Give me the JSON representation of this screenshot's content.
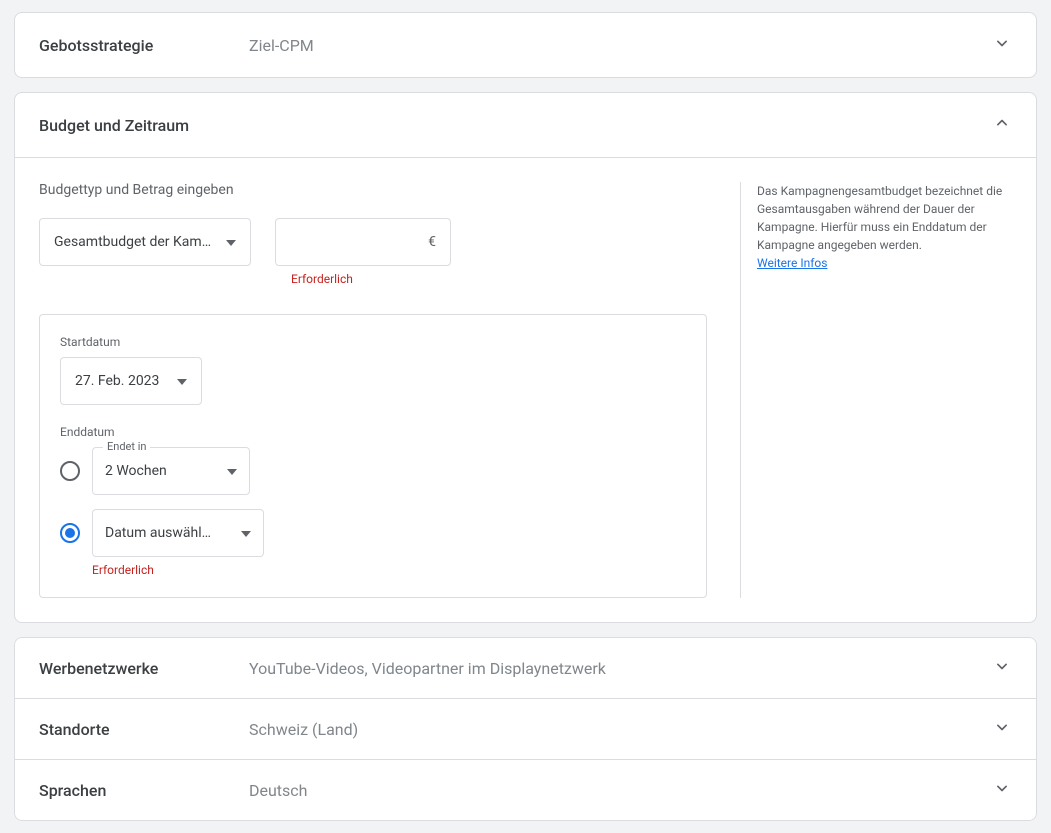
{
  "bidStrategy": {
    "title": "Gebotsstrategie",
    "summary": "Ziel-CPM"
  },
  "budget": {
    "title": "Budget und Zeitraum",
    "formLabel": "Budgettyp und Betrag eingeben",
    "budgetTypeSelected": "Gesamtbudget der Kampagne",
    "currencySymbol": "€",
    "amountError": "Erforderlich",
    "startDateLabel": "Startdatum",
    "startDateValue": "27. Feb. 2023",
    "endDateLabel": "Enddatum",
    "endsInFloatLabel": "Endet in",
    "endsInValue": "2 Wochen",
    "selectDateLabel": "Datum auswähl…",
    "selectDateError": "Erforderlich",
    "help": {
      "text": "Das Kampagnengesamtbudget bezeichnet die Gesamtausgaben während der Dauer der Kampagne. Hierfür muss ein Enddatum der Kampagne angegeben werden.",
      "linkText": "Weitere Infos"
    }
  },
  "networks": {
    "title": "Werbenetzwerke",
    "summary": "YouTube-Videos, Videopartner im Displaynetzwerk"
  },
  "locations": {
    "title": "Standorte",
    "summary": "Schweiz (Land)"
  },
  "languages": {
    "title": "Sprachen",
    "summary": "Deutsch"
  }
}
